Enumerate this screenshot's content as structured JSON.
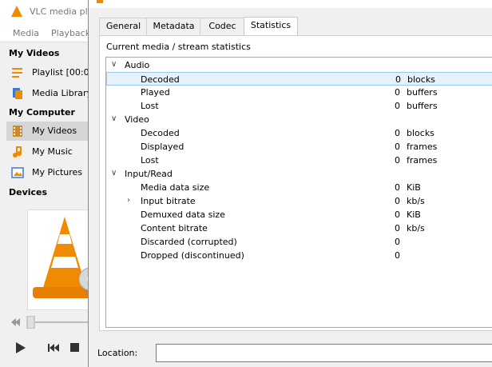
{
  "vlc": {
    "title": "VLC media pla",
    "menu": [
      "Media",
      "Playback"
    ],
    "sections": {
      "my_videos": "My Videos",
      "my_computer": "My Computer",
      "devices": "Devices"
    },
    "items": {
      "playlist": "Playlist [00:00",
      "media_library": "Media Library",
      "my_videos": "My Videos",
      "my_music": "My Music",
      "my_pictures": "My Pictures"
    },
    "colors": {
      "accent": "#f08a00"
    }
  },
  "dialog": {
    "tabs": [
      "General",
      "Metadata",
      "Codec",
      "Statistics"
    ],
    "active_tab": "Statistics",
    "panel_title": "Current media / stream statistics",
    "location_label": "Location:",
    "location_value": "",
    "stats": {
      "audio": {
        "label": "Audio",
        "rows": [
          {
            "name": "Decoded",
            "value": "0",
            "unit": "blocks"
          },
          {
            "name": "Played",
            "value": "0",
            "unit": "buffers"
          },
          {
            "name": "Lost",
            "value": "0",
            "unit": "buffers"
          }
        ]
      },
      "video": {
        "label": "Video",
        "rows": [
          {
            "name": "Decoded",
            "value": "0",
            "unit": "blocks"
          },
          {
            "name": "Displayed",
            "value": "0",
            "unit": "frames"
          },
          {
            "name": "Lost",
            "value": "0",
            "unit": "frames"
          }
        ]
      },
      "input": {
        "label": "Input/Read",
        "rows": [
          {
            "name": "Media data size",
            "value": "0",
            "unit": "KiB"
          },
          {
            "name": "Input bitrate",
            "value": "0",
            "unit": "kb/s"
          },
          {
            "name": "Demuxed data size",
            "value": "0",
            "unit": "KiB"
          },
          {
            "name": "Content bitrate",
            "value": "0",
            "unit": "kb/s"
          },
          {
            "name": "Discarded (corrupted)",
            "value": "0",
            "unit": ""
          },
          {
            "name": "Dropped (discontinued)",
            "value": "0",
            "unit": ""
          }
        ]
      }
    }
  }
}
